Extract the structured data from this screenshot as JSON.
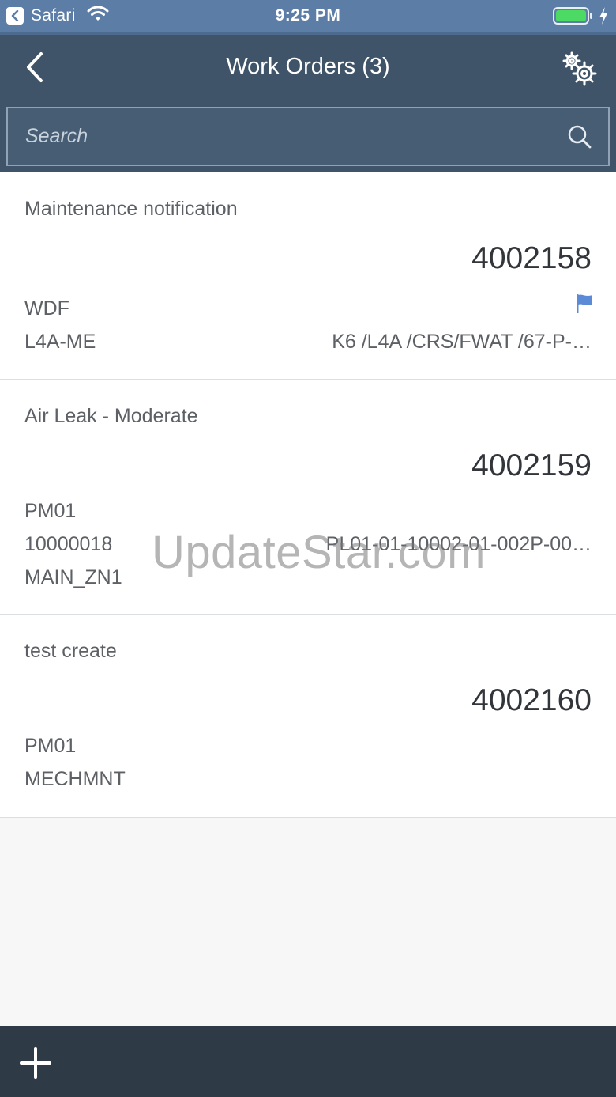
{
  "status_bar": {
    "app": "Safari",
    "time": "9:25 PM"
  },
  "nav": {
    "title": "Work Orders (3)"
  },
  "search": {
    "placeholder": "Search"
  },
  "work_orders": [
    {
      "title": "Maintenance notification",
      "number": "4002158",
      "line1": "WDF",
      "line2": "L4A-ME",
      "right2": "K6 /L4A /CRS/FWAT /67-P-…",
      "flagged": true
    },
    {
      "title": "Air Leak - Moderate",
      "number": "4002159",
      "line1": "PM01",
      "line2": "10000018",
      "line3": "MAIN_ZN1",
      "right2": "PL01-01-10002-01-002P-00…"
    },
    {
      "title": "test create",
      "number": "4002160",
      "line1": "PM01",
      "line2": "MECHMNT"
    }
  ],
  "watermark": "UpdateStar.com",
  "colors": {
    "status_bar": "#5b7da6",
    "nav_bar": "#3f5468",
    "footer": "#2e3a46",
    "flag": "#5b8bd6",
    "battery": "#4cd964"
  },
  "icons": {
    "back": "chevron-left-icon",
    "settings": "gears-icon",
    "search": "search-icon",
    "flag": "flag-icon",
    "add": "plus-icon"
  }
}
